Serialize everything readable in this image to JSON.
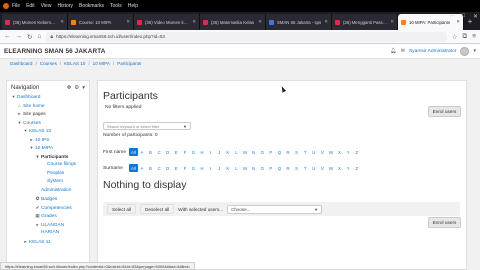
{
  "browser": {
    "menu": [
      "File",
      "Edit",
      "View",
      "History",
      "Bookmarks",
      "Tools",
      "Help"
    ],
    "tabs": [
      {
        "title": "(36) Momen Kebersamaan",
        "icon": "youtube-favicon",
        "active": false
      },
      {
        "title": "Course: 10 MIPA",
        "icon": "moodle-favicon",
        "active": false
      },
      {
        "title": "(36) Video Momen kebersamaan",
        "icon": "youtube-favicon",
        "active": false
      },
      {
        "title": "(36) Matematika Kelas",
        "icon": "youtube-favicon",
        "active": false
      },
      {
        "title": "SMAN 56 Jakarta - sps",
        "icon": "generic-favicon",
        "active": false
      },
      {
        "title": "(36) Mengganti Passwo",
        "icon": "youtube-favicon",
        "active": false
      },
      {
        "title": "10 MIPA: Participants",
        "icon": "moodle-favicon",
        "active": true
      }
    ],
    "new_tab": "+",
    "url": "https://elearning.sman56.sch.id/user/index.php?id=53",
    "status_url": "https://elearning.sman56.sch.id/user/index.php?contextid=0&roleid=0&id=53&perpage=5000&tilast=&tifirst="
  },
  "site": {
    "name": "ELEARNING SMAN 56 JAKARTA",
    "user": "Syamsir Administrator"
  },
  "breadcrumb": [
    "Dashboard",
    "Courses",
    "KELAS 10",
    "10 MIPA",
    "Participants"
  ],
  "nav_block": {
    "title": "Navigation",
    "items": [
      {
        "label": "Dashboard",
        "level": 0,
        "style": "link",
        "icon": "caret-down-icon"
      },
      {
        "label": "Site home",
        "level": 1,
        "style": "link",
        "icon": "home-icon"
      },
      {
        "label": "Site pages",
        "level": 1,
        "style": "plain",
        "icon": "caret-right-icon"
      },
      {
        "label": "Courses",
        "level": 1,
        "style": "link",
        "icon": "caret-down-icon"
      },
      {
        "label": "KELAS 10",
        "level": 2,
        "style": "link",
        "icon": "caret-down-icon"
      },
      {
        "label": "10 IPS",
        "level": 3,
        "style": "link",
        "icon": "caret-right-icon"
      },
      {
        "label": "10 MIPA",
        "level": 3,
        "style": "link",
        "icon": "caret-down-icon"
      },
      {
        "label": "Participants",
        "level": 4,
        "style": "bold",
        "icon": "caret-down-icon"
      },
      {
        "label": "Course filings",
        "level": 5,
        "style": "link",
        "icon": ""
      },
      {
        "label": "Peoples",
        "level": 5,
        "style": "link",
        "icon": ""
      },
      {
        "label": "System",
        "level": 5,
        "style": "link",
        "icon": ""
      },
      {
        "label": "Administration",
        "level": 4,
        "style": "link",
        "icon": ""
      },
      {
        "label": "Badges",
        "level": 4,
        "style": "link",
        "icon": "badge-icon"
      },
      {
        "label": "Competencies",
        "level": 4,
        "style": "link",
        "icon": "check-icon"
      },
      {
        "label": "Grades",
        "level": 4,
        "style": "link",
        "icon": "grid-icon"
      },
      {
        "label": "ULANGAN",
        "level": 4,
        "style": "link",
        "icon": "caret-right-icon"
      },
      {
        "label": "HARIAN",
        "level": 4,
        "style": "link",
        "icon": ""
      },
      {
        "label": "KELAS 11",
        "level": 2,
        "style": "link",
        "icon": "caret-right-icon"
      }
    ]
  },
  "main": {
    "title": "Participants",
    "no_filters": "No filters applied",
    "enrol_button": "Enrol users",
    "keyword_placeholder": "Search keyword or select filter",
    "participant_count": "Number of participants: 0",
    "firstname_label": "First name",
    "surname_label": "Surname",
    "all_label": "All",
    "letters": [
      "A",
      "B",
      "C",
      "D",
      "E",
      "F",
      "G",
      "H",
      "I",
      "J",
      "K",
      "L",
      "M",
      "N",
      "O",
      "P",
      "Q",
      "R",
      "S",
      "T",
      "U",
      "V",
      "W",
      "X",
      "Y",
      "Z"
    ],
    "nothing": "Nothing to display",
    "select_all": "Select all",
    "deselect_all": "Deselect all",
    "with_selected": "With selected users...",
    "choose": "Choose..."
  },
  "colors": {
    "link": "#1177d1",
    "text": "#333333",
    "tab_active_bg": "#f9f9fb"
  }
}
